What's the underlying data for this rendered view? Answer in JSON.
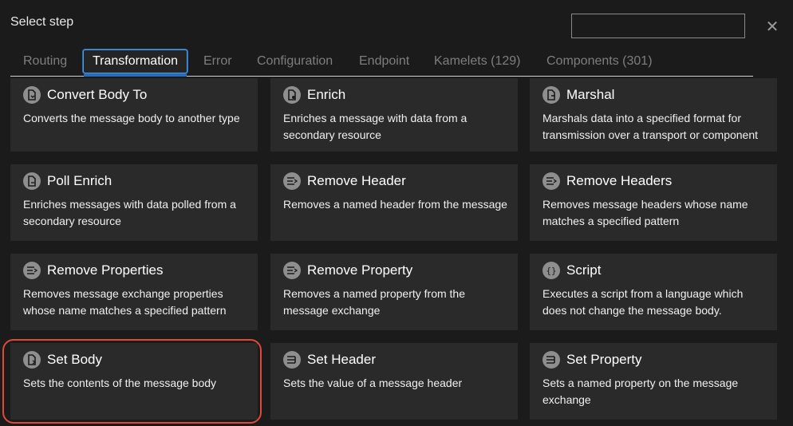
{
  "dialog": {
    "title": "Select step",
    "search_value": "",
    "close_icon": "close-icon"
  },
  "tabs": [
    {
      "label": "Routing",
      "active": false
    },
    {
      "label": "Transformation",
      "active": true
    },
    {
      "label": "Error",
      "active": false
    },
    {
      "label": "Configuration",
      "active": false
    },
    {
      "label": "Endpoint",
      "active": false
    },
    {
      "label": "Kamelets (129)",
      "active": false
    },
    {
      "label": "Components (301)",
      "active": false
    }
  ],
  "cards": [
    {
      "title": "Convert Body To",
      "description": "Converts the message body to another type",
      "icon": "document-convert-icon"
    },
    {
      "title": "Enrich",
      "description": "Enriches a message with data from a secondary resource",
      "icon": "document-enrich-icon"
    },
    {
      "title": "Marshal",
      "description": "Marshals data into a specified format for transmission over a transport or component",
      "icon": "document-marshal-icon"
    },
    {
      "title": "Poll Enrich",
      "description": "Enriches messages with data polled from a secondary resource",
      "icon": "document-poll-icon"
    },
    {
      "title": "Remove Header",
      "description": "Removes a named header from the message",
      "icon": "remove-lines-icon"
    },
    {
      "title": "Remove Headers",
      "description": "Removes message headers whose name matches a specified pattern",
      "icon": "remove-lines-icon"
    },
    {
      "title": "Remove Properties",
      "description": "Removes message exchange properties whose name matches a specified pattern",
      "icon": "remove-lines-icon"
    },
    {
      "title": "Remove Property",
      "description": "Removes a named property from the message exchange",
      "icon": "remove-lines-icon"
    },
    {
      "title": "Script",
      "description": "Executes a script from a language which does not change the message body.",
      "icon": "braces-icon"
    },
    {
      "title": "Set Body",
      "description": "Sets the contents of the message body",
      "icon": "document-set-icon",
      "highlighted": true
    },
    {
      "title": "Set Header",
      "description": "Sets the value of a message header",
      "icon": "set-lines-icon"
    },
    {
      "title": "Set Property",
      "description": "Sets a named property on the message exchange",
      "icon": "set-lines-icon"
    }
  ],
  "colors": {
    "accent": "#2b6cb8",
    "highlight": "#e0493a",
    "card_bg": "#2a2a2a",
    "page_bg": "#1b1b1b"
  }
}
